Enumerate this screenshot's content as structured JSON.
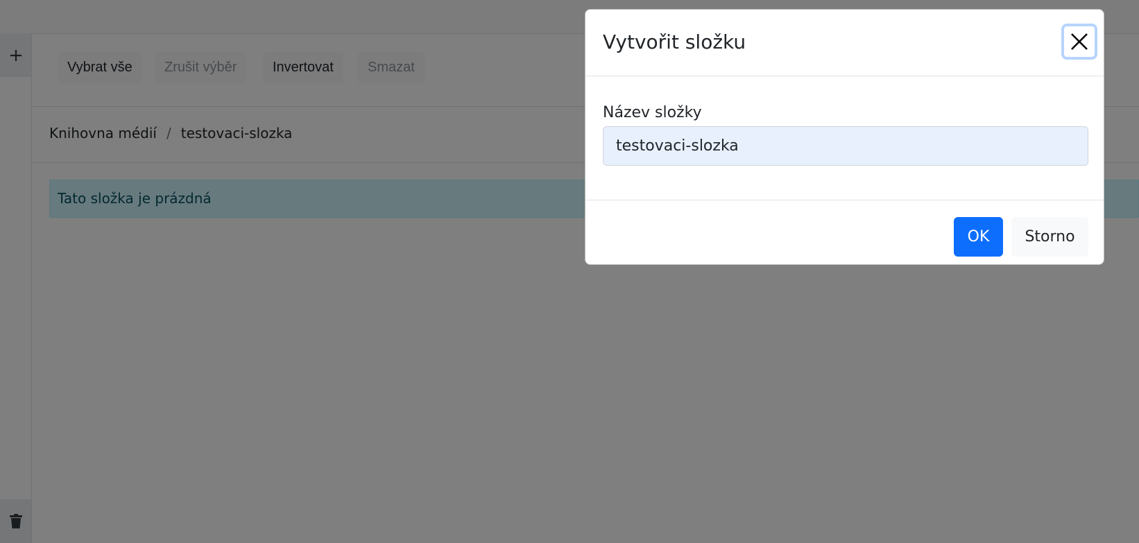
{
  "toolbar": {
    "select_all": "Vybrat vše",
    "clear_selection": "Zrušit výběr",
    "invert": "Invertovat",
    "delete": "Smazat"
  },
  "rail": {
    "add_icon": "plus-icon",
    "trash_icon": "trash-icon"
  },
  "breadcrumb": {
    "root": "Knihovna médií",
    "separator": "/",
    "current": "testovaci-slozka"
  },
  "alert": {
    "text": "Tato složka je prázdná"
  },
  "modal": {
    "title": "Vytvořit složku",
    "close_icon": "close-icon",
    "field_label": "Název složky",
    "field_value": "testovaci-slozka",
    "ok_label": "OK",
    "cancel_label": "Storno"
  },
  "colors": {
    "primary": "#0d6efd",
    "alert_bg": "#cff4fc",
    "alert_text": "#055160",
    "input_bg": "#e8f0fe",
    "backdrop": "rgba(0,0,0,0.5)"
  }
}
